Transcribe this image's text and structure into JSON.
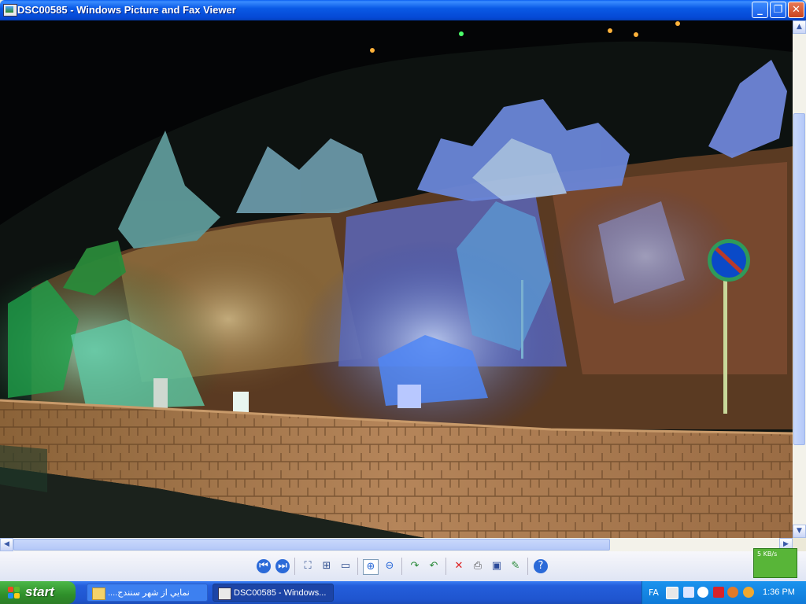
{
  "window": {
    "title": "DSC00585 - Windows Picture and Fax Viewer"
  },
  "toolbar": {
    "net_speed": "5 KB/s"
  },
  "taskbar": {
    "start_label": "start",
    "tasks": [
      {
        "label": "....نمايي از شهر سنندج"
      },
      {
        "label": "DSC00585 - Windows..."
      }
    ],
    "language": "FA",
    "clock": "1:36 PM"
  },
  "photo": {
    "sign_color": "#0a4ac8",
    "accent_blue": "#2d6cf5",
    "accent_green": "#3aa84a"
  }
}
